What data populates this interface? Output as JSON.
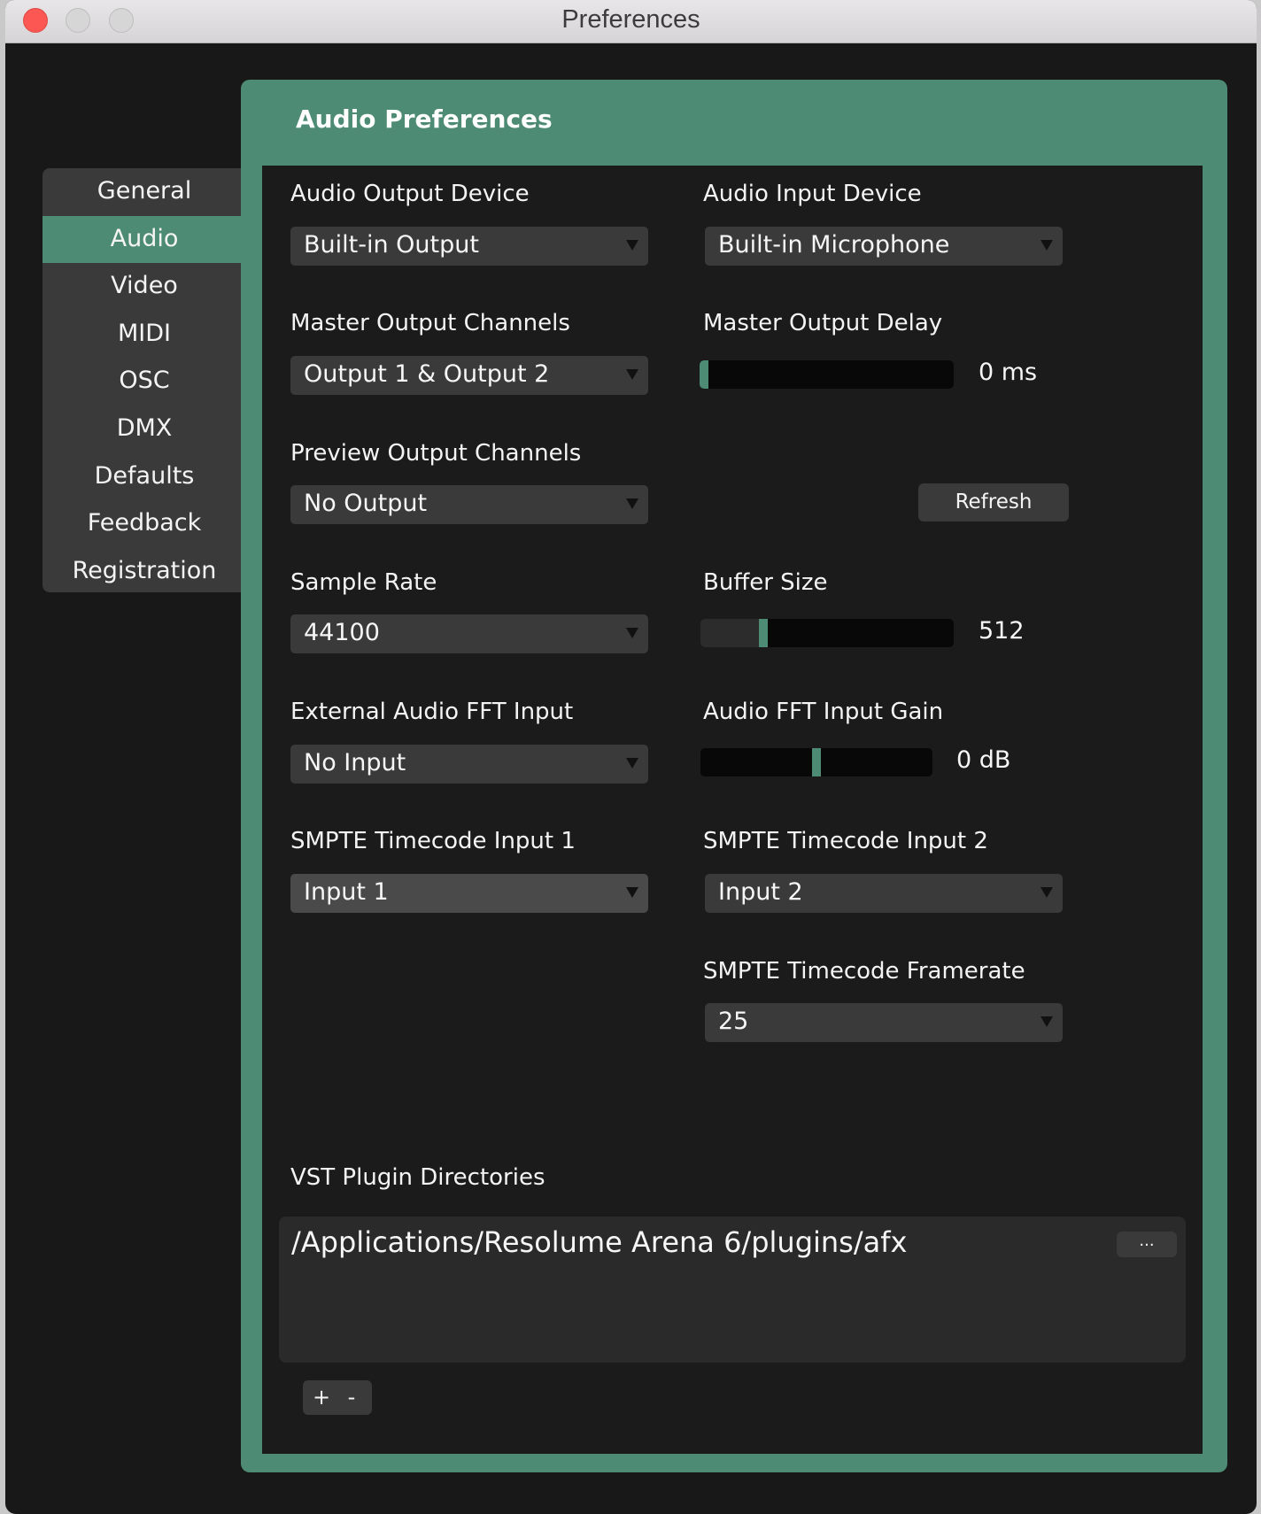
{
  "window": {
    "title": "Preferences",
    "controls": [
      "close",
      "minimize",
      "zoom"
    ]
  },
  "sidebar": {
    "items": [
      {
        "label": "General",
        "active": false
      },
      {
        "label": "Audio",
        "active": true
      },
      {
        "label": "Video",
        "active": false
      },
      {
        "label": "MIDI",
        "active": false
      },
      {
        "label": "OSC",
        "active": false
      },
      {
        "label": "DMX",
        "active": false
      },
      {
        "label": "Defaults",
        "active": false
      },
      {
        "label": "Feedback",
        "active": false
      },
      {
        "label": "Registration",
        "active": false
      }
    ]
  },
  "panel": {
    "title": "Audio Preferences",
    "accent_color": "#4d8b74",
    "audio_output_device": {
      "label": "Audio Output Device",
      "value": "Built-in Output"
    },
    "audio_input_device": {
      "label": "Audio Input Device",
      "value": "Built-in Microphone"
    },
    "master_output_channels": {
      "label": "Master Output Channels",
      "value": "Output 1 & Output 2"
    },
    "master_output_delay": {
      "label": "Master Output Delay",
      "value_text": "0 ms",
      "fraction": 0.0
    },
    "preview_output_channels": {
      "label": "Preview Output Channels",
      "value": "No Output"
    },
    "refresh_label": "Refresh",
    "sample_rate": {
      "label": "Sample Rate",
      "value": "44100"
    },
    "buffer_size": {
      "label": "Buffer Size",
      "value_text": "512",
      "fraction": 0.24
    },
    "external_fft_input": {
      "label": "External Audio FFT Input",
      "value": "No Input"
    },
    "fft_input_gain": {
      "label": "Audio FFT Input Gain",
      "value_text": "0 dB",
      "fraction": 0.5
    },
    "smpte_input_1": {
      "label": "SMPTE Timecode Input 1",
      "value": "Input 1"
    },
    "smpte_input_2": {
      "label": "SMPTE Timecode Input 2",
      "value": "Input 2"
    },
    "smpte_framerate": {
      "label": "SMPTE Timecode Framerate",
      "value": "25"
    },
    "vst": {
      "label": "VST Plugin Directories",
      "directories": [
        "/Applications/Resolume Arena 6/plugins/afx"
      ],
      "browse_label": "...",
      "add_label": "+",
      "remove_label": "-"
    }
  }
}
